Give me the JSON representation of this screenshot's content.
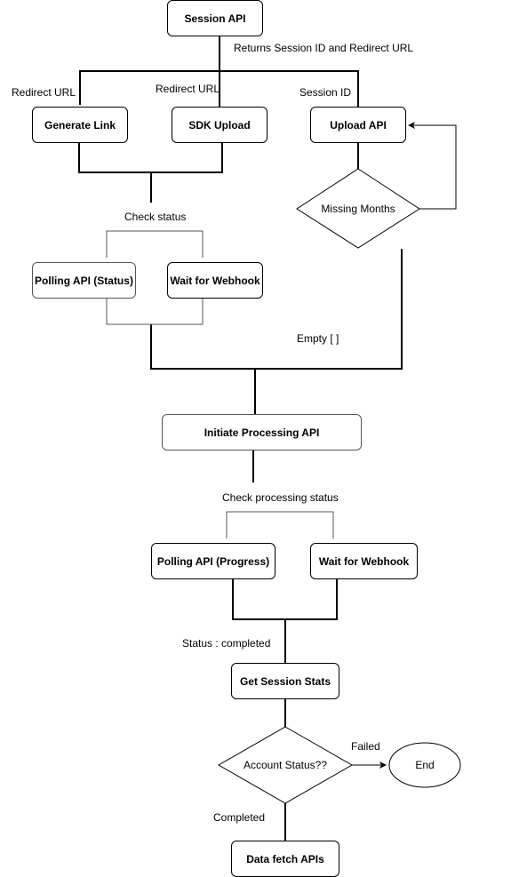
{
  "nodes": {
    "session_api": "Session API",
    "generate_link": "Generate Link",
    "sdk_upload": "SDK Upload",
    "upload_api": "Upload API",
    "missing_months": "Missing Months",
    "polling_status": "Polling API (Status)",
    "wait_webhook_1": "Wait for Webhook",
    "initiate_processing": "Initiate Processing API",
    "polling_progress": "Polling API (Progress)",
    "wait_webhook_2": "Wait for Webhook",
    "get_session_stats": "Get Session Stats",
    "account_status": "Account Status??",
    "end": "End",
    "data_fetch": "Data fetch APIs"
  },
  "edge_labels": {
    "returns": "Returns Session ID and Redirect URL",
    "redirect_url_1": "Redirect URL",
    "redirect_url_2": "Redirect URL",
    "session_id": "Session ID",
    "check_status": "Check status",
    "empty": "Empty [ ]",
    "check_processing_status": "Check processing status",
    "status_completed": "Status : completed",
    "failed": "Failed",
    "completed": "Completed"
  }
}
